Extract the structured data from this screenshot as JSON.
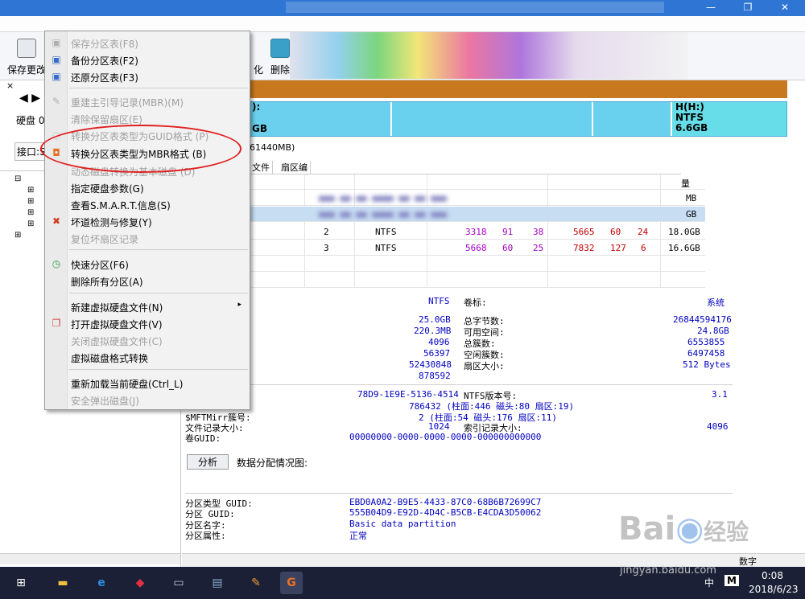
{
  "window": {
    "min_glyph": "—",
    "max_glyph": "❐",
    "close_glyph": "✕"
  },
  "toolbar": {
    "save_label": "保存更改",
    "partial_label_1": "化",
    "delete_label": "删除"
  },
  "left_panel": {
    "close_glyph": "×",
    "nav_glyph": "◀ ▶",
    "disk_label": "硬盘 0",
    "interface_label": "接口:S"
  },
  "disk_bar": {
    "segments": [
      {
        "name": "):",
        "size": "GB"
      },
      {
        "name": "",
        "size": ""
      },
      {
        "name": "",
        "size": ""
      },
      {
        "name": "H(H:)",
        "fs": "NTFS",
        "size": "6.6GB"
      }
    ]
  },
  "disk_info_fragment": "61440MB)",
  "tabs": [
    "文件",
    "扇区编"
  ],
  "partition_table": {
    "header_tail": "量",
    "rows": [
      {
        "seq": "2",
        "fs": "NTFS",
        "start_cyl": "3318",
        "head": "91",
        "sector": "38",
        "end_cyl": "5665",
        "end_head": "60",
        "end_sector": "24",
        "size": "18.0GB"
      },
      {
        "seq": "3",
        "fs": "NTFS",
        "start_cyl": "5668",
        "head": "60",
        "sector": "25",
        "end_cyl": "7832",
        "end_head": "127",
        "end_sector": "6",
        "size": "16.6GB"
      }
    ],
    "blurred_sizes": [
      "MB",
      "GB"
    ]
  },
  "details": {
    "fs_type": "NTFS",
    "volume_label_key": "卷标:",
    "volume_label_val": "系统",
    "rows_left": [
      "25.0GB",
      "220.3MB",
      "4096",
      "56397",
      "52430848",
      "878592"
    ],
    "rows_right": [
      {
        "key": "总字节数:",
        "val": "26844594176"
      },
      {
        "key": "可用空间:",
        "val": "24.8GB"
      },
      {
        "key": "总簇数:",
        "val": "6553855"
      },
      {
        "key": "空闲簇数:",
        "val": "6497458"
      },
      {
        "key": "扇区大小:",
        "val": "512 Bytes"
      }
    ],
    "serial": "78D9-1E9E-5136-4514",
    "ntfs_version_key": "NTFS版本号:",
    "ntfs_version": "3.1",
    "mft_val": "786432 (柱面:446 磁头:80 扇区:19)",
    "mftmirr_key": "$MFTMirr簇号:",
    "mftmirr_val": "2 (柱面:54 磁头:176 扇区:11)",
    "file_record_key": "文件记录大小:",
    "file_record_val": "1024",
    "index_record_key": "索引记录大小:",
    "index_record_val": "4096",
    "volume_guid_key": "卷GUID:",
    "volume_guid_val": "00000000-0000-0000-0000-000000000000",
    "analyze_button": "分析",
    "alloc_label": "数据分配情况图:",
    "type_guid_key": "分区类型 GUID:",
    "type_guid_val": "EBD0A0A2-B9E5-4433-87C0-68B6B72699C7",
    "part_guid_key": "分区 GUID:",
    "part_guid_val": "555B04D9-E92D-4D4C-B5CB-E4CDA3D50062",
    "part_name_key": "分区名字:",
    "part_name_val": "Basic data partition",
    "part_attr_key": "分区属性:",
    "part_attr_val": "正常"
  },
  "status": {
    "numlock": "数字"
  },
  "context_menu": {
    "items": [
      {
        "label": "保存分区表(F8)",
        "disabled": true
      },
      {
        "label": "备份分区表(F2)",
        "disabled": false
      },
      {
        "label": "还原分区表(F3)",
        "disabled": false
      },
      {
        "label": "重建主引导记录(MBR)(M)",
        "disabled": true
      },
      {
        "label": "清除保留扇区(E)",
        "disabled": true
      },
      {
        "label": "转换分区表类型为GUID格式 (P)",
        "disabled": true
      },
      {
        "label": "转换分区表类型为MBR格式 (B)",
        "disabled": false
      },
      {
        "label": "动态磁盘转换为基本磁盘 (D)",
        "disabled": true
      },
      {
        "label": "指定硬盘参数(G)",
        "disabled": false
      },
      {
        "label": "查看S.M.A.R.T.信息(S)",
        "disabled": false
      },
      {
        "label": "坏道检测与修复(Y)",
        "disabled": false
      },
      {
        "label": "复位坏扇区记录",
        "disabled": true
      },
      {
        "label": "快速分区(F6)",
        "disabled": false
      },
      {
        "label": "删除所有分区(A)",
        "disabled": false
      },
      {
        "label": "新建虚拟硬盘文件(N)",
        "disabled": false,
        "submenu": true
      },
      {
        "label": "打开虚拟硬盘文件(V)",
        "disabled": false
      },
      {
        "label": "关闭虚拟硬盘文件(C)",
        "disabled": true
      },
      {
        "label": "虚拟磁盘格式转换",
        "disabled": false
      },
      {
        "label": "重新加载当前硬盘(Ctrl_L)",
        "disabled": false
      },
      {
        "label": "安全弹出磁盘(J)",
        "disabled": true
      }
    ],
    "submenu_glyph": "▸"
  },
  "taskbar": {
    "ime": "中",
    "ime_mode": "M",
    "time": "0:08",
    "date": "2018/6/23"
  },
  "watermark": {
    "brand": "Bai",
    "brand_cn": "经验",
    "url": "jingyan.baidu.com"
  },
  "colors": {
    "accent": "#2f76d4",
    "highlight_circle": "#e02020",
    "disk_bar": "#66ccee",
    "taskbar": "#1b2036"
  }
}
